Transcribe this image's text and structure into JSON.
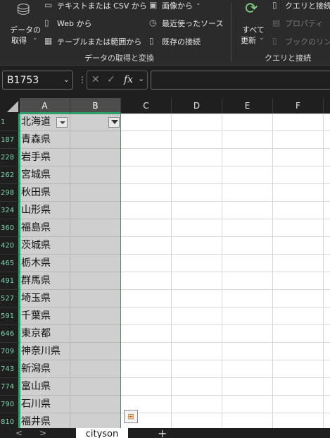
{
  "ribbon": {
    "get_data_label": "データの",
    "get_data_label2": "取得",
    "text_csv": "テキストまたは CSV から",
    "web": "Web から",
    "table_range": "テーブルまたは範囲から",
    "from_image": "画像から",
    "recent_sources": "最近使ったソース",
    "existing_connections": "既存の接続",
    "group1_label": "データの取得と変換",
    "refresh_all_label": "すべて",
    "refresh_all_label2": "更新",
    "queries_connections": "クエリと接続",
    "properties": "プロパティ",
    "edit_links": "ブックのリンク",
    "group2_label": "クエリと接続"
  },
  "formula_bar": {
    "name_box": "B1753",
    "fx": "fx",
    "formula": ""
  },
  "grid": {
    "columns": [
      "A",
      "B",
      "C",
      "D",
      "E",
      "F"
    ],
    "rows": [
      {
        "num": "1",
        "a": "北海道"
      },
      {
        "num": "187",
        "a": "青森県"
      },
      {
        "num": "228",
        "a": "岩手県"
      },
      {
        "num": "262",
        "a": "宮城県"
      },
      {
        "num": "298",
        "a": "秋田県"
      },
      {
        "num": "324",
        "a": "山形県"
      },
      {
        "num": "360",
        "a": "福島県"
      },
      {
        "num": "420",
        "a": "茨城県"
      },
      {
        "num": "465",
        "a": "栃木県"
      },
      {
        "num": "491",
        "a": "群馬県"
      },
      {
        "num": "527",
        "a": "埼玉県"
      },
      {
        "num": "591",
        "a": "千葉県"
      },
      {
        "num": "646",
        "a": "東京都"
      },
      {
        "num": "709",
        "a": "神奈川県"
      },
      {
        "num": "743",
        "a": "新潟県"
      },
      {
        "num": "774",
        "a": "富山県"
      },
      {
        "num": "790",
        "a": "石川県"
      },
      {
        "num": "810",
        "a": "福井県"
      }
    ]
  },
  "sheet_tabs": {
    "active": "cityson",
    "add": "+",
    "prev": "<",
    "next": ">"
  }
}
